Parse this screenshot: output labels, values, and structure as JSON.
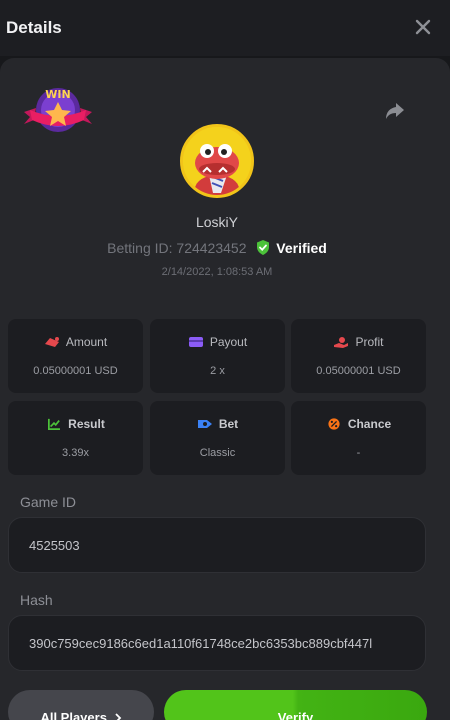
{
  "header": {
    "title": "Details",
    "close_icon": "close-icon"
  },
  "badge": {
    "text": "WIN"
  },
  "player": {
    "name": "LoskiY",
    "betting_label": "Betting ID:",
    "betting_id": "724423452",
    "verified_label": "Verified",
    "datetime": "2/14/2022, 1:08:53 AM"
  },
  "stats": [
    {
      "label": "Amount",
      "value": "0.05000001 USD",
      "icon": "amount-icon",
      "color": "#e5484d"
    },
    {
      "label": "Payout",
      "value": "2 x",
      "icon": "payout-icon",
      "color": "#8b5cf6"
    },
    {
      "label": "Profit",
      "value": "0.05000001 USD",
      "icon": "profit-icon",
      "color": "#e5484d"
    },
    {
      "label": "Result",
      "value": "3.39x",
      "icon": "result-icon",
      "color": "#4cc23a"
    },
    {
      "label": "Bet",
      "value": "Classic",
      "icon": "bet-icon",
      "color": "#3b82f6"
    },
    {
      "label": "Chance",
      "value": "-",
      "icon": "chance-icon",
      "color": "#f97316"
    }
  ],
  "game_id": {
    "label": "Game ID",
    "value": "4525503"
  },
  "hash": {
    "label": "Hash",
    "value": "390c759cec9186c6ed1a110f61748ce2bc6353bc889cbf447l"
  },
  "buttons": {
    "all_players": "All Players",
    "verify": "Verify"
  },
  "colors": {
    "accent_green": "#52c41a",
    "background": "#17181b",
    "panel": "#26272b"
  }
}
